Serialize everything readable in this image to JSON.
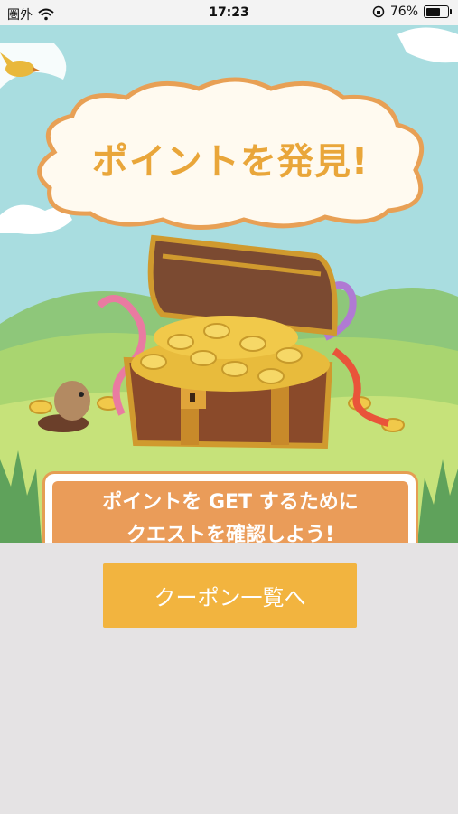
{
  "status_bar": {
    "carrier": "圏外",
    "time": "17:23",
    "battery_percent": "76%",
    "battery_level": 0.76
  },
  "banner": {
    "title": "ポイントを発見!",
    "message_line1": "ポイントを GET するために",
    "message_line2": "クエストを確認しよう!"
  },
  "actions": {
    "coupon_button": "クーポン一覧へ"
  },
  "colors": {
    "sky": "#a9dde0",
    "accent_orange": "#ea9c59",
    "button_yellow": "#f2b43f",
    "background": "#e5e3e4"
  }
}
